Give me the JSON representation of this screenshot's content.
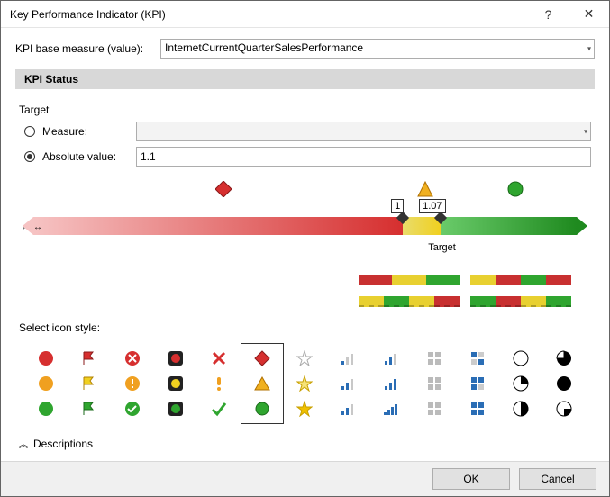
{
  "window": {
    "title": "Key Performance Indicator (KPI)",
    "help": "?",
    "close": "✕"
  },
  "base_measure": {
    "label": "KPI base measure (value):",
    "value": "InternetCurrentQuarterSalesPerformance"
  },
  "status_header": "KPI Status",
  "target": {
    "label": "Target",
    "measure_label": "Measure:",
    "absolute_label": "Absolute value:",
    "measure_selected": false,
    "absolute_selected": true,
    "measure_value": "",
    "absolute_value": "1.1"
  },
  "slider": {
    "thresholds": [
      "1",
      "1.07"
    ],
    "target_label": "Target",
    "left_color": "#d62f2f",
    "mid_color": "#f0d020",
    "right_color": "#2fa52f",
    "left_pct": 68,
    "mid_pct": 7,
    "right_pct": 25
  },
  "patterns": {
    "a": [
      "#c83030",
      "#e8d030",
      "#2fa52f"
    ],
    "b": [
      "#e8d030",
      "#c83030",
      "#2fa52f",
      "#c83030"
    ],
    "c": [
      "#e8d030",
      "#2fa52f",
      "#e8d030",
      "#c83030"
    ],
    "d": [
      "#2fa52f",
      "#c83030",
      "#e8d030",
      "#2fa52f"
    ]
  },
  "icon_style_label": "Select icon style:",
  "icon_columns": [
    {
      "id": "circles",
      "icons": [
        "circle-red",
        "circle-orange",
        "circle-green"
      ]
    },
    {
      "id": "flags",
      "icons": [
        "flag-red",
        "flag-yellow",
        "flag-green"
      ]
    },
    {
      "id": "badges",
      "icons": [
        "badge-x",
        "badge-excl",
        "badge-check"
      ]
    },
    {
      "id": "lights",
      "icons": [
        "light-red",
        "light-yellow",
        "light-green"
      ]
    },
    {
      "id": "marks",
      "icons": [
        "x-mark",
        "exclaim",
        "check"
      ]
    },
    {
      "id": "gems",
      "icons": [
        "diamond-red",
        "triangle-orange",
        "circle-green2"
      ],
      "selected": true
    },
    {
      "id": "stars",
      "icons": [
        "star-outline",
        "star-half",
        "star-full"
      ]
    },
    {
      "id": "bars-a",
      "icons": [
        "bars-low",
        "bars-mid",
        "bars-mid2"
      ]
    },
    {
      "id": "bars-b",
      "icons": [
        "bars-b-low",
        "bars-b-mid",
        "bars-b-high"
      ]
    },
    {
      "id": "squares-a",
      "icons": [
        "squares-gray",
        "squares-gray2",
        "squares-gray3"
      ]
    },
    {
      "id": "squares-b",
      "icons": [
        "squares-blue",
        "squares-blue2",
        "squares-blue3"
      ]
    },
    {
      "id": "pies",
      "icons": [
        "pie-0",
        "pie-25",
        "pie-50"
      ]
    },
    {
      "id": "pies-b",
      "icons": [
        "pie-75",
        "pie-100",
        "pie-empty"
      ]
    }
  ],
  "descriptions_label": "Descriptions",
  "buttons": {
    "ok": "OK",
    "cancel": "Cancel"
  }
}
